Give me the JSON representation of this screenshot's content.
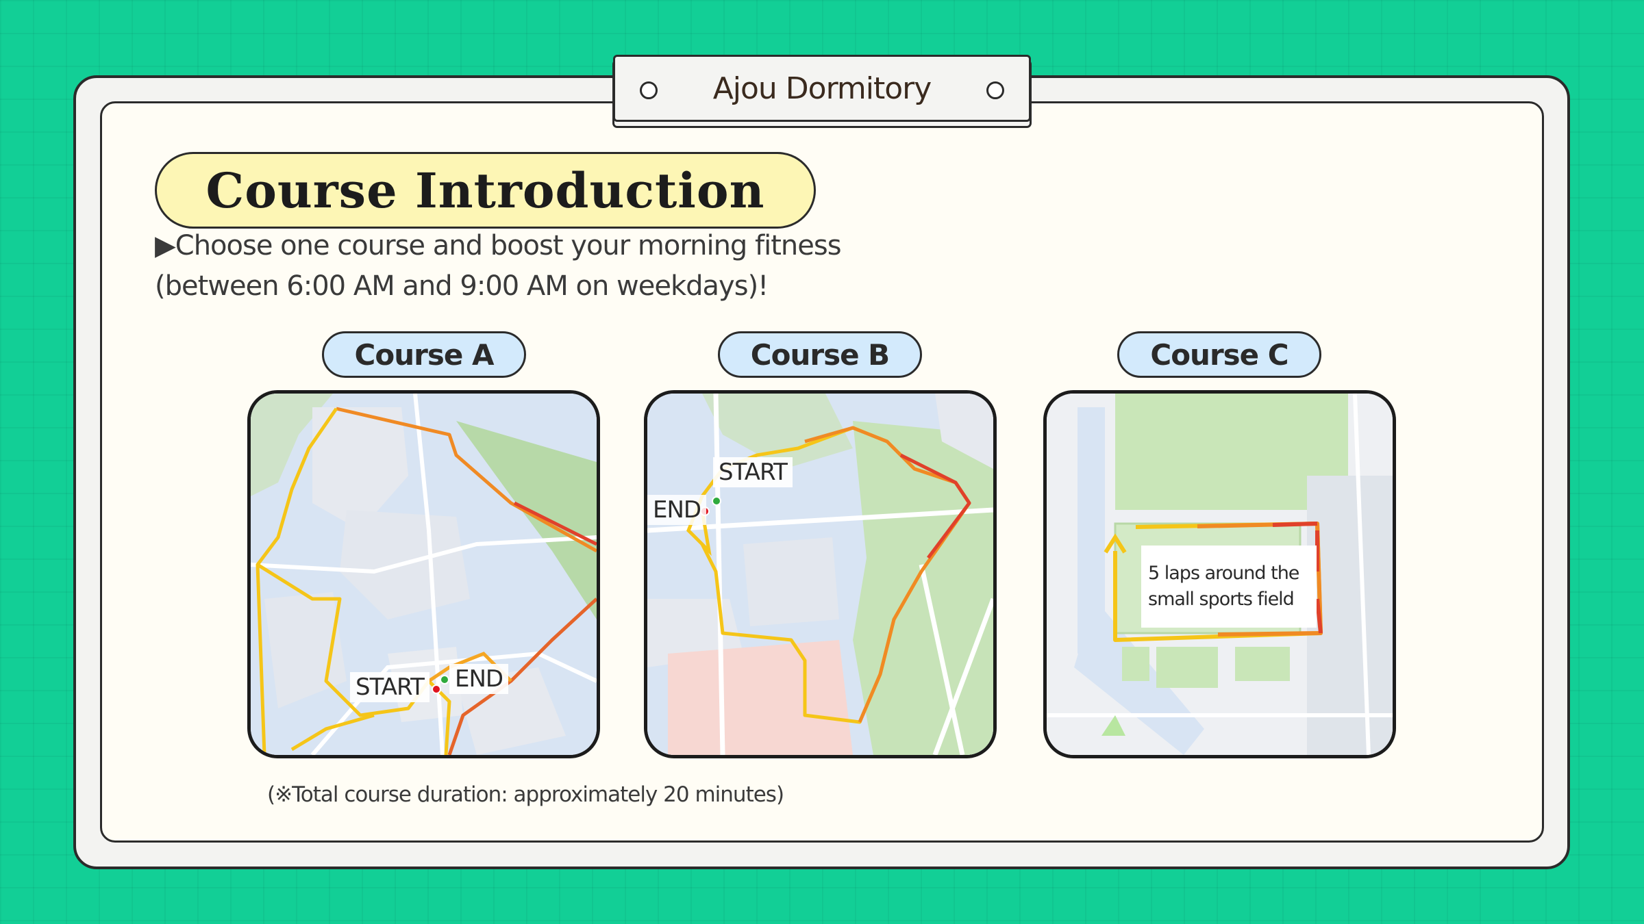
{
  "tab": {
    "title": "Ajou Dormitory"
  },
  "heading": {
    "title": "Course Introduction"
  },
  "subtitle": {
    "line1": "▶Choose one course and boost your morning fitness",
    "line2": "(between 6:00 AM and 9:00 AM on weekdays)!"
  },
  "courses": [
    {
      "label": "Course A",
      "start_label": "START",
      "end_label": "END"
    },
    {
      "label": "Course B",
      "start_label": "START",
      "end_label": "END"
    },
    {
      "label": "Course C",
      "info_line1": "5 laps around the",
      "info_line2": "small sports field"
    }
  ],
  "footnote": "(※Total course duration: approximately 20 minutes)",
  "colors": {
    "background": "#12cf96",
    "panel": "#fffdf5",
    "heading_pill": "#fdf6b5",
    "course_pill": "#d3eafc",
    "route_yellow": "#f5c518",
    "route_orange": "#f08a24",
    "route_red": "#e0412b",
    "start_dot": "#2eaa3c",
    "end_dot": "#e0141e"
  }
}
